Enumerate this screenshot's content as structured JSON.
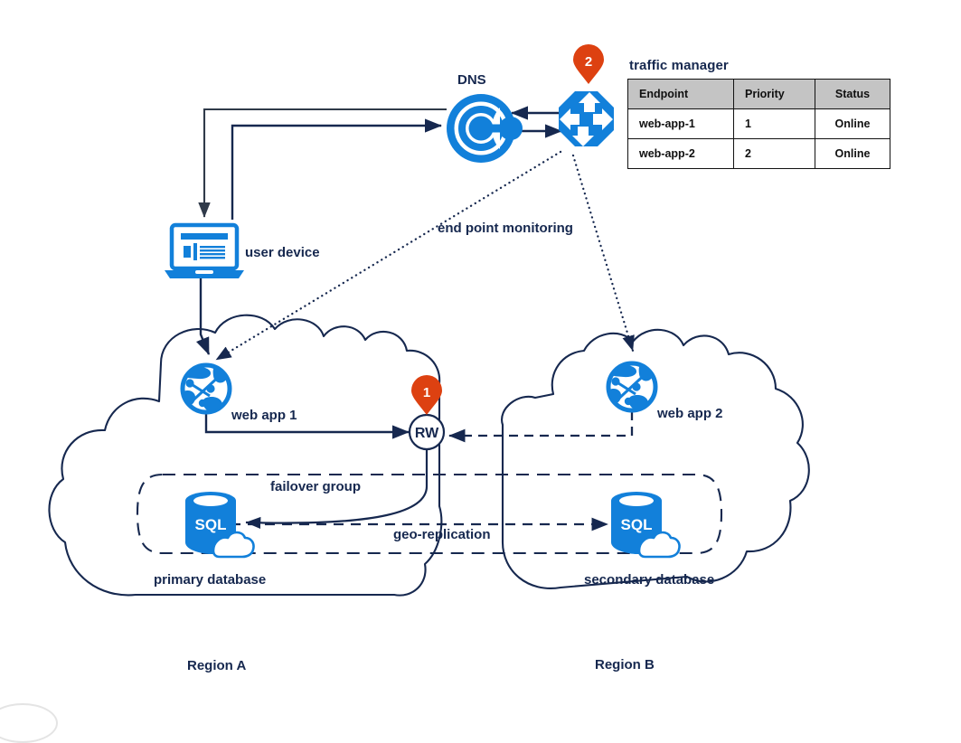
{
  "diagram": {
    "title": "Azure multi-region failover architecture",
    "colors": {
      "navy": "#16284f",
      "azure": "#1280da",
      "azure_dark": "#0f6cbd",
      "orange_pin": "#dd4111",
      "table_header_gray": "#c4c4c4",
      "status_green": "#00c431",
      "black": "#101010"
    }
  },
  "traffic_manager": {
    "title": "traffic manager",
    "columns": [
      "Endpoint",
      "Priority",
      "Status"
    ],
    "rows": [
      {
        "endpoint": "web-app-1",
        "priority": "1",
        "status": "Online",
        "status_state": "highlighted"
      },
      {
        "endpoint": "web-app-2",
        "priority": "2",
        "status": "Online",
        "status_state": "normal"
      }
    ]
  },
  "nodes": {
    "dns": {
      "label": "DNS"
    },
    "traffic_manager_icon": {
      "pin_number": "2"
    },
    "user_device": {
      "label": "user device"
    },
    "web_app_1": {
      "label": "web app 1"
    },
    "web_app_2": {
      "label": "web app 2"
    },
    "rw_endpoint": {
      "label": "RW",
      "pin_number": "1"
    },
    "primary_database": {
      "label": "primary database",
      "badge": "SQL"
    },
    "secondary_database": {
      "label": "secondary database",
      "badge": "SQL"
    }
  },
  "groups": {
    "failover_group": {
      "label": "failover group"
    },
    "region_a": {
      "label": "Region A"
    },
    "region_b": {
      "label": "Region B"
    }
  },
  "connections": {
    "end_point_monitoring": {
      "label": "end point monitoring"
    },
    "geo_replication": {
      "label": "geo-replication"
    }
  }
}
